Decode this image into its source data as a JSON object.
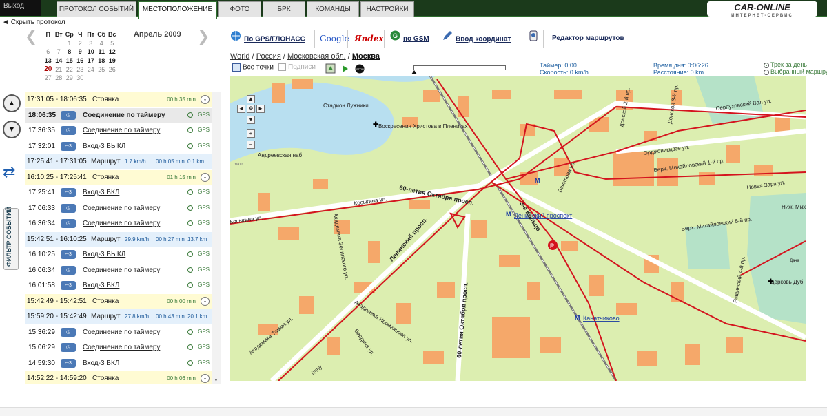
{
  "header": {
    "logout": "Выход",
    "tabs": [
      "ПРОТОКОЛ СОБЫТИЙ",
      "МЕСТОПОЛОЖЕНИЕ",
      "ФОТО",
      "БРК",
      "КОМАНДЫ",
      "НАСТРОЙКИ"
    ],
    "active_tab": "МЕСТОПОЛОЖЕНИЕ",
    "logo_main": "CAR-ONLINE",
    "logo_sub": "ИНТЕРНЕТ-СЕРВИС"
  },
  "sidebar": {
    "hide_protocol": "Скрыть протокол",
    "calendar": {
      "month": "Апрель 2009",
      "weekdays": [
        "П",
        "Вт",
        "Ср",
        "Ч",
        "Пт",
        "Сб",
        "Вс"
      ],
      "weeks": [
        [
          "",
          "",
          "1",
          "2",
          "3",
          "4",
          "5"
        ],
        [
          "6",
          "7",
          "8",
          "9",
          "10",
          "11",
          "12"
        ],
        [
          "13",
          "14",
          "15",
          "16",
          "17",
          "18",
          "19"
        ],
        [
          "20",
          "21",
          "22",
          "23",
          "24",
          "25",
          "26"
        ],
        [
          "27",
          "28",
          "29",
          "30",
          "",
          "",
          ""
        ]
      ],
      "today": "20"
    },
    "filter_label": "ФИЛЬТР СОБЫТИЙ",
    "gps_label": "GPS",
    "events": [
      {
        "type": "stop",
        "time": "17:31:05 - 18:06:35",
        "label": "Стоянка",
        "duration": "00 h 35 min"
      },
      {
        "type": "event",
        "time": "18:06:35",
        "label": "Соединение по таймеру",
        "selected": true
      },
      {
        "type": "event",
        "time": "17:36:35",
        "label": "Соединение по таймеру"
      },
      {
        "type": "event",
        "time": "17:32:01",
        "label": "Вход-3 ВЫКЛ"
      },
      {
        "type": "route",
        "time": "17:25:41 - 17:31:05",
        "label": "Маршрут",
        "speed": "1.7 km/h",
        "duration": "00 h 05 min",
        "distance": "0.1 km"
      },
      {
        "type": "stop",
        "time": "16:10:25 - 17:25:41",
        "label": "Стоянка",
        "duration": "01 h 15 min"
      },
      {
        "type": "event",
        "time": "17:25:41",
        "label": "Вход-3 ВКЛ"
      },
      {
        "type": "event",
        "time": "17:06:33",
        "label": "Соединение по таймеру"
      },
      {
        "type": "event",
        "time": "16:36:34",
        "label": "Соединение по таймеру"
      },
      {
        "type": "route",
        "time": "15:42:51 - 16:10:25",
        "label": "Маршрут",
        "speed": "29.9 km/h",
        "duration": "00 h 27 min",
        "distance": "13.7 km"
      },
      {
        "type": "event",
        "time": "16:10:25",
        "label": "Вход-3 ВЫКЛ"
      },
      {
        "type": "event",
        "time": "16:06:34",
        "label": "Соединение по таймеру"
      },
      {
        "type": "event",
        "time": "16:01:58",
        "label": "Вход-3 ВКЛ"
      },
      {
        "type": "stop",
        "time": "15:42:49 - 15:42:51",
        "label": "Стоянка",
        "duration": "00 h 00 min"
      },
      {
        "type": "route",
        "time": "15:59:20 - 15:42:49",
        "label": "Маршрут",
        "speed": "27.8 km/h",
        "duration": "00 h 43 min",
        "distance": "20.1 km"
      },
      {
        "type": "event",
        "time": "15:36:29",
        "label": "Соединение по таймеру"
      },
      {
        "type": "event",
        "time": "15:06:29",
        "label": "Соединение по таймеру"
      },
      {
        "type": "event",
        "time": "14:59:30",
        "label": "Вход-3 ВКЛ"
      },
      {
        "type": "stop",
        "time": "14:52:22 - 14:59:20",
        "label": "Стоянка",
        "duration": "00 h 06 min"
      }
    ]
  },
  "map_toolbar": {
    "gps": "По GPS/ГЛОНАСС",
    "google": "Google",
    "yandex": "Яndex",
    "gsm": "по GSM",
    "coords": "Ввод координат",
    "routes": "Редактор маршрутов"
  },
  "breadcrumb": [
    "World",
    "Россия",
    "Московская обл.",
    "Москва"
  ],
  "controls": {
    "all_points": "Все точки",
    "signatures": "Подписи",
    "progress": 0
  },
  "stats": {
    "timer": "Таймер: 0:00",
    "speed": "Скорость: 0 km/h",
    "day_time": "Время дня: 0:06:26",
    "distance": "Расстояние: 0 km",
    "track_day": "Трек за день",
    "selected_route": "Выбранный маршрут"
  },
  "map_labels": {
    "stadium": "Стадион Лужники",
    "church1": "Воскресения Христова в Плениках",
    "andreev": "Андреевская наб",
    "oct60a": "60-летия Октября просп.",
    "oct60b": "60-летия Октября просп.",
    "lenin_prosp": "Ленинский просп.",
    "metro_lenin": "Ленинский проспект",
    "metro_kanat": "Канатчиково",
    "kosygin": "Косыгина ул.",
    "vavilov": "Вавилова ул.",
    "donskaya2": "Донской 2-й пр.",
    "donskaya3": "Донской 3-й пр.",
    "serpukh": "Серпуховский Вал ул.",
    "ordzh": "Орджоникидзе ул.",
    "mikh1": "Верх. Михайловский 1-й пр.",
    "mikh5": "Верх. Михайловский 5-й пр.",
    "novaya": "Новая Заря ул.",
    "nizh": "Ниж. Мих.",
    "church2": "церковь Дуб",
    "ring3": "3-е Кольцо",
    "nesmeyanova": "Академика Несмеянова ул.",
    "tamma": "Академика Тамма ул.",
    "vardina": "Бардина ул.",
    "lyapun": "Ляпу",
    "rosh": "Рощинский 4-й пр.",
    "zelinsky": "Академика Зелинского ул.",
    "kuzbas": "Косыгина ул.",
    "dacha": "Дача",
    "maxr": "maxr"
  }
}
